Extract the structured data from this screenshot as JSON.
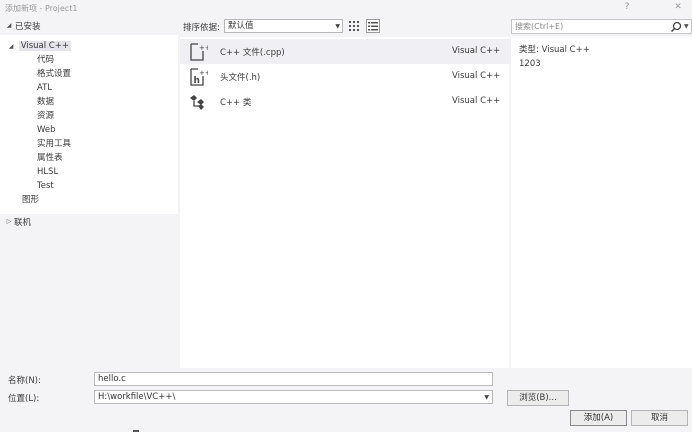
{
  "window": {
    "title": "添加新项 - Project1",
    "help_label": "?",
    "close_label": "✕"
  },
  "left_panel": {
    "installed_label": "已安装",
    "tree": [
      {
        "label": "Visual C++",
        "selected": true
      },
      {
        "label": "代码"
      },
      {
        "label": "格式设置"
      },
      {
        "label": "ATL"
      },
      {
        "label": "数据"
      },
      {
        "label": "资源"
      },
      {
        "label": "Web"
      },
      {
        "label": "实用工具"
      },
      {
        "label": "属性表"
      },
      {
        "label": "HLSL"
      },
      {
        "label": "Test"
      },
      {
        "label": "图形"
      }
    ],
    "online_label": "联机"
  },
  "toolbar": {
    "sort_label": "排序依据:",
    "sort_value": "默认值",
    "grid_view_icon": "grid-view-icon",
    "list_view_icon": "list-view-icon"
  },
  "templates": [
    {
      "name": "C++ 文件(.cpp)",
      "type": "Visual C++",
      "icon": "cpp-file-icon",
      "selected": true
    },
    {
      "name": "头文件(.h)",
      "type": "Visual C++",
      "icon": "header-file-icon"
    },
    {
      "name": "C++ 类",
      "type": "Visual C++",
      "icon": "cpp-class-icon"
    }
  ],
  "search": {
    "placeholder": "搜索(Ctrl+E)",
    "icon": "search-icon"
  },
  "details": {
    "type_label": "类型:",
    "type_value": "Visual C++",
    "id_value": "1203"
  },
  "form": {
    "name_label": "名称(N):",
    "name_value": "hello.c",
    "location_label": "位置(L):",
    "location_value": "H:\\workfile\\VC++\\",
    "browse_label": "浏览(B)...",
    "add_label": "添加(A)",
    "cancel_label": "取消"
  },
  "colors": {
    "background": "#f4f4f6",
    "panel": "#ffffff",
    "selection": "#e4e4ea",
    "border": "#b8b8b8",
    "text": "#3a3a3a",
    "muted_text": "#9a9a9a"
  }
}
